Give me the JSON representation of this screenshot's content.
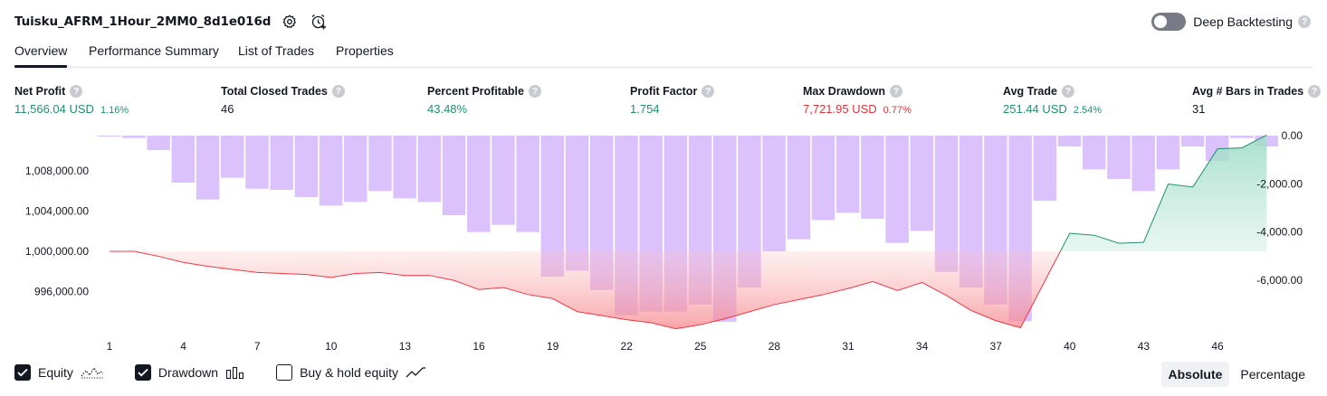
{
  "header": {
    "strategy_name": "Tuisku_AFRM_1Hour_2MM0_8d1e016d",
    "deep_backtesting_label": "Deep Backtesting",
    "help_glyph": "?"
  },
  "tabs": [
    {
      "label": "Overview",
      "active": true
    },
    {
      "label": "Performance Summary",
      "active": false
    },
    {
      "label": "List of Trades",
      "active": false
    },
    {
      "label": "Properties",
      "active": false
    }
  ],
  "metrics": [
    {
      "label": "Net Profit",
      "value": "11,566.04 USD",
      "pct": "1.16%",
      "tone": "pos"
    },
    {
      "label": "Total Closed Trades",
      "value": "46",
      "pct": "",
      "tone": "plain"
    },
    {
      "label": "Percent Profitable",
      "value": "43.48%",
      "pct": "",
      "tone": "pos"
    },
    {
      "label": "Profit Factor",
      "value": "1.754",
      "pct": "",
      "tone": "pos"
    },
    {
      "label": "Max Drawdown",
      "value": "7,721.95 USD",
      "pct": "0.77%",
      "tone": "neg"
    },
    {
      "label": "Avg Trade",
      "value": "251.44 USD",
      "pct": "2.54%",
      "tone": "pos"
    },
    {
      "label": "Avg # Bars in Trades",
      "value": "31",
      "pct": "",
      "tone": "plain"
    }
  ],
  "chart_data": {
    "type": "area",
    "x_ticks": [
      "1",
      "4",
      "7",
      "10",
      "13",
      "16",
      "19",
      "22",
      "25",
      "28",
      "31",
      "34",
      "37",
      "40",
      "43",
      "46"
    ],
    "left_axis_ticks": [
      "1,008,000.00",
      "1,004,000.00",
      "1,000,000.00",
      "996,000.00"
    ],
    "right_axis_ticks": [
      "0.00",
      "-2,000.00",
      "-4,000.00",
      "-6,000.00"
    ],
    "initial_capital": 1000000,
    "equity": [
      {
        "trade": 1,
        "value": 1000000
      },
      {
        "trade": 2,
        "value": 1000000
      },
      {
        "trade": 3,
        "value": 999500
      },
      {
        "trade": 4,
        "value": 998900
      },
      {
        "trade": 5,
        "value": 998500
      },
      {
        "trade": 6,
        "value": 998200
      },
      {
        "trade": 7,
        "value": 997900
      },
      {
        "trade": 8,
        "value": 997800
      },
      {
        "trade": 9,
        "value": 997700
      },
      {
        "trade": 10,
        "value": 997400
      },
      {
        "trade": 11,
        "value": 997800
      },
      {
        "trade": 12,
        "value": 997900
      },
      {
        "trade": 13,
        "value": 997600
      },
      {
        "trade": 14,
        "value": 997600
      },
      {
        "trade": 15,
        "value": 997100
      },
      {
        "trade": 16,
        "value": 996200
      },
      {
        "trade": 17,
        "value": 996400
      },
      {
        "trade": 18,
        "value": 995700
      },
      {
        "trade": 19,
        "value": 995300
      },
      {
        "trade": 20,
        "value": 994000
      },
      {
        "trade": 21,
        "value": 993600
      },
      {
        "trade": 22,
        "value": 993200
      },
      {
        "trade": 23,
        "value": 992900
      },
      {
        "trade": 24,
        "value": 992300
      },
      {
        "trade": 25,
        "value": 992700
      },
      {
        "trade": 26,
        "value": 993300
      },
      {
        "trade": 27,
        "value": 994000
      },
      {
        "trade": 28,
        "value": 994700
      },
      {
        "trade": 29,
        "value": 995200
      },
      {
        "trade": 30,
        "value": 995700
      },
      {
        "trade": 31,
        "value": 996300
      },
      {
        "trade": 32,
        "value": 997000
      },
      {
        "trade": 33,
        "value": 996100
      },
      {
        "trade": 34,
        "value": 996900
      },
      {
        "trade": 35,
        "value": 995600
      },
      {
        "trade": 36,
        "value": 994100
      },
      {
        "trade": 37,
        "value": 993100
      },
      {
        "trade": 38,
        "value": 992400
      },
      {
        "trade": 39,
        "value": 997100
      },
      {
        "trade": 40,
        "value": 1001800
      },
      {
        "trade": 41,
        "value": 1001600
      },
      {
        "trade": 42,
        "value": 1000800
      },
      {
        "trade": 43,
        "value": 1000900
      },
      {
        "trade": 44,
        "value": 1006700
      },
      {
        "trade": 45,
        "value": 1006400
      },
      {
        "trade": 46,
        "value": 1010200
      },
      {
        "trade": 47,
        "value": 1010300
      },
      {
        "trade": 48,
        "value": 1011566
      }
    ],
    "drawdown": [
      {
        "trade": 1,
        "value": 0
      },
      {
        "trade": 2,
        "value": -100
      },
      {
        "trade": 3,
        "value": -600
      },
      {
        "trade": 4,
        "value": -1950
      },
      {
        "trade": 5,
        "value": -2650
      },
      {
        "trade": 6,
        "value": -1750
      },
      {
        "trade": 7,
        "value": -2200
      },
      {
        "trade": 8,
        "value": -2250
      },
      {
        "trade": 9,
        "value": -2550
      },
      {
        "trade": 10,
        "value": -2900
      },
      {
        "trade": 11,
        "value": -2750
      },
      {
        "trade": 12,
        "value": -2300
      },
      {
        "trade": 13,
        "value": -2600
      },
      {
        "trade": 14,
        "value": -2750
      },
      {
        "trade": 15,
        "value": -3300
      },
      {
        "trade": 16,
        "value": -4000
      },
      {
        "trade": 17,
        "value": -3700
      },
      {
        "trade": 18,
        "value": -4000
      },
      {
        "trade": 19,
        "value": -5850
      },
      {
        "trade": 20,
        "value": -5600
      },
      {
        "trade": 21,
        "value": -6400
      },
      {
        "trade": 22,
        "value": -7450
      },
      {
        "trade": 23,
        "value": -7300
      },
      {
        "trade": 24,
        "value": -7300
      },
      {
        "trade": 25,
        "value": -7000
      },
      {
        "trade": 26,
        "value": -7722
      },
      {
        "trade": 27,
        "value": -6300
      },
      {
        "trade": 28,
        "value": -4800
      },
      {
        "trade": 29,
        "value": -4300
      },
      {
        "trade": 30,
        "value": -3500
      },
      {
        "trade": 31,
        "value": -3200
      },
      {
        "trade": 32,
        "value": -3450
      },
      {
        "trade": 33,
        "value": -4450
      },
      {
        "trade": 34,
        "value": -3950
      },
      {
        "trade": 35,
        "value": -5650
      },
      {
        "trade": 36,
        "value": -6300
      },
      {
        "trade": 37,
        "value": -7000
      },
      {
        "trade": 38,
        "value": -7700
      },
      {
        "trade": 39,
        "value": -2700
      },
      {
        "trade": 40,
        "value": -450
      },
      {
        "trade": 41,
        "value": -1400
      },
      {
        "trade": 42,
        "value": -1800
      },
      {
        "trade": 43,
        "value": -2300
      },
      {
        "trade": 44,
        "value": -1400
      },
      {
        "trade": 45,
        "value": -450
      },
      {
        "trade": 46,
        "value": -1050
      },
      {
        "trade": 47,
        "value": -100
      },
      {
        "trade": 48,
        "value": -450
      }
    ],
    "colors": {
      "equity_up": "#22906f",
      "equity_down": "#f23645",
      "drawdown_bar": "#d6b7fd",
      "equity_up_fill": "#c8ecdf",
      "equity_down_fill": "#fbbdbf"
    }
  },
  "legend": {
    "equity_label": "Equity",
    "drawdown_label": "Drawdown",
    "buyhold_label": "Buy & hold equity",
    "equity_checked": true,
    "drawdown_checked": true,
    "buyhold_checked": false
  },
  "scale": {
    "absolute_label": "Absolute",
    "percentage_label": "Percentage",
    "selected": "Absolute"
  }
}
